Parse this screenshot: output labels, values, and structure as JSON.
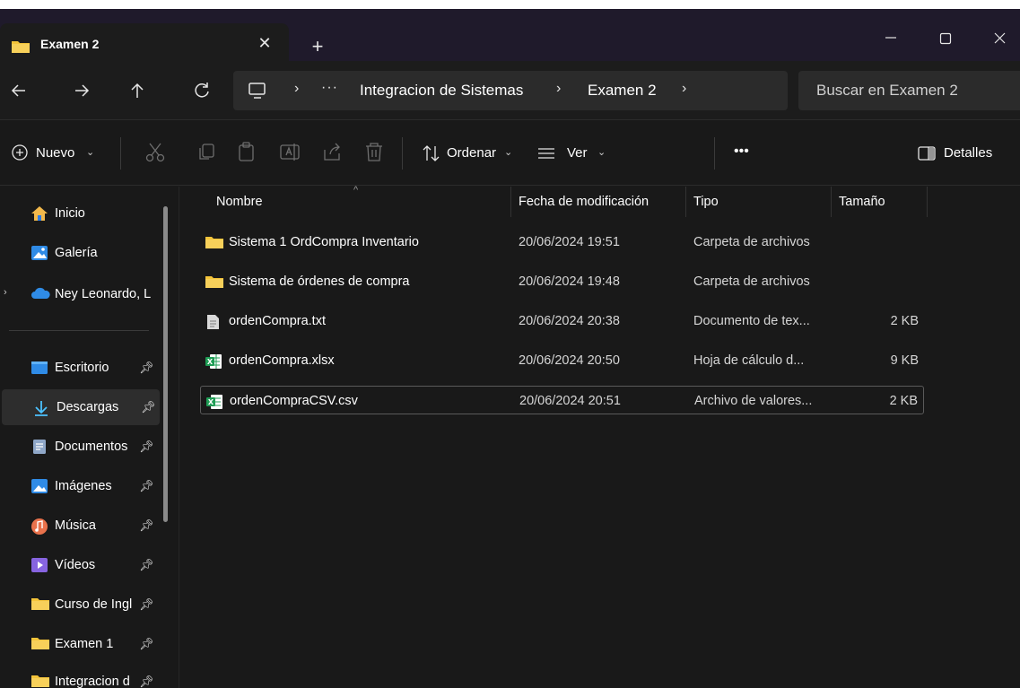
{
  "window": {
    "tab_title": "Examen 2",
    "tab_close": "✕",
    "new_tab": "+"
  },
  "address": {
    "crumb_more": "···",
    "crumbs": [
      "Integracion de Sistemas",
      "Examen 2"
    ],
    "search_placeholder": "Buscar en Examen 2"
  },
  "commands": {
    "new": "Nuevo",
    "sort": "Ordenar",
    "view": "Ver",
    "more": "•••",
    "details": "Detalles"
  },
  "sidebar": {
    "items": [
      {
        "label": "Inicio",
        "icon": "home-icon"
      },
      {
        "label": "Galería",
        "icon": "gallery-icon"
      },
      {
        "label": "Ney Leonardo, L",
        "icon": "onedrive-icon"
      },
      {
        "label": "Escritorio",
        "icon": "desktop-icon"
      },
      {
        "label": "Descargas",
        "icon": "download-icon"
      },
      {
        "label": "Documentos",
        "icon": "documents-icon"
      },
      {
        "label": "Imágenes",
        "icon": "pictures-icon"
      },
      {
        "label": "Música",
        "icon": "music-icon"
      },
      {
        "label": "Vídeos",
        "icon": "videos-icon"
      },
      {
        "label": "Curso de Ingl",
        "icon": "folder-icon"
      },
      {
        "label": "Examen 1",
        "icon": "folder-icon"
      },
      {
        "label": "Integracion d",
        "icon": "folder-icon"
      }
    ]
  },
  "filelist": {
    "columns": {
      "name": "Nombre",
      "date": "Fecha de modificación",
      "type": "Tipo",
      "size": "Tamaño"
    },
    "rows": [
      {
        "name": "Sistema 1 OrdCompra Inventario",
        "date": "20/06/2024 19:51",
        "type": "Carpeta de archivos",
        "size": "",
        "icon": "folder-icon"
      },
      {
        "name": "Sistema de órdenes de compra",
        "date": "20/06/2024 19:48",
        "type": "Carpeta de archivos",
        "size": "",
        "icon": "folder-icon"
      },
      {
        "name": "ordenCompra.txt",
        "date": "20/06/2024 20:38",
        "type": "Documento de tex...",
        "size": "2 KB",
        "icon": "text-file-icon"
      },
      {
        "name": "ordenCompra.xlsx",
        "date": "20/06/2024 20:50",
        "type": "Hoja de cálculo d...",
        "size": "9 KB",
        "icon": "excel-file-icon"
      },
      {
        "name": "ordenCompraCSV.csv",
        "date": "20/06/2024 20:51",
        "type": "Archivo de valores...",
        "size": "2 KB",
        "icon": "csv-file-icon"
      }
    ]
  },
  "colors": {
    "folder": "#f4c43a",
    "excel": "#1f9d55",
    "accent": "#4cc2ff"
  }
}
